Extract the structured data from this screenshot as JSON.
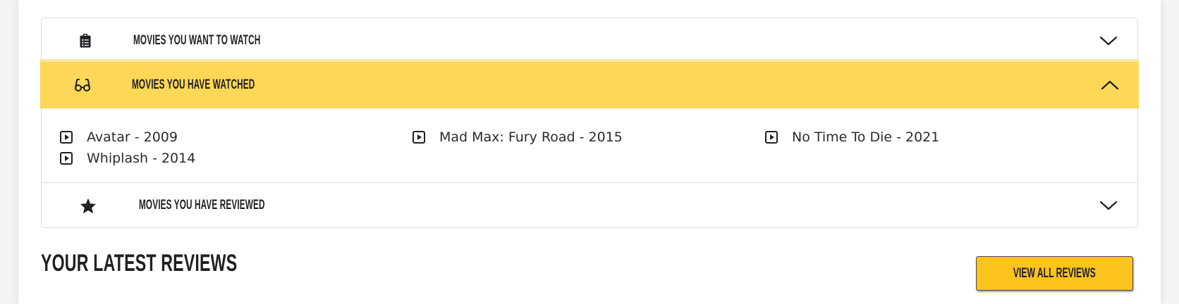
{
  "accordion": {
    "sections": [
      {
        "label": "Movies you want to watch",
        "icon": "clipboard-list-icon",
        "expanded": false
      },
      {
        "label": "Movies you have watched",
        "icon": "glasses-icon",
        "expanded": true
      },
      {
        "label": "Movies you have reviewed",
        "icon": "star-icon",
        "expanded": false
      }
    ],
    "watched_movies": [
      "Avatar - 2009",
      "Mad Max: Fury Road - 2015",
      "No Time To Die - 2021",
      "Whiplash - 2014"
    ]
  },
  "latest_reviews": {
    "title": "Your latest reviews",
    "button_label": "View all reviews"
  },
  "colors": {
    "accent_yellow": "#fdd756",
    "button_yellow": "#fdc41e",
    "text_dark": "#1f2024"
  }
}
